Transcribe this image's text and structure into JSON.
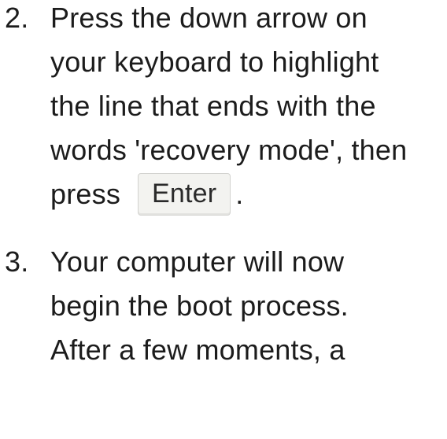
{
  "steps": [
    {
      "number": "2.",
      "lines": [
        "Press the down arrow on",
        "your keyboard to highlight",
        "the line that ends with the",
        "words 'recovery mode', then"
      ],
      "last_line_prefix": "press",
      "key_label": "Enter",
      "last_line_suffix": "."
    },
    {
      "number": "3.",
      "lines": [
        "Your computer will now",
        "begin the boot process.",
        "After a few moments, a"
      ]
    }
  ]
}
